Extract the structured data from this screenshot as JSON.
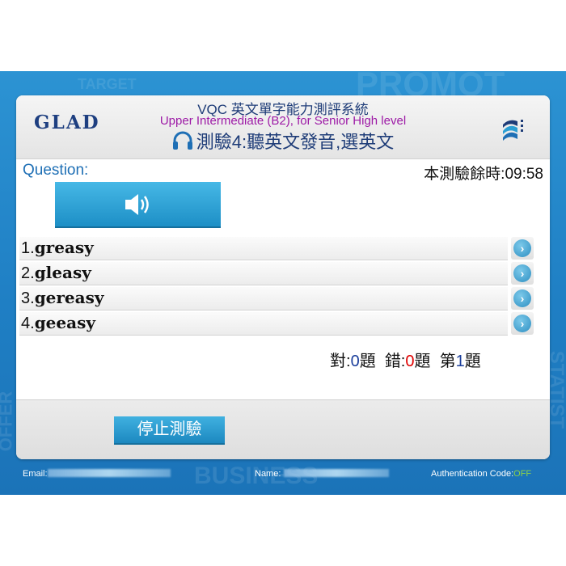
{
  "background_words": [
    "TARGET",
    "PROMOT",
    "BUSINESS",
    "OFFER",
    "STATIST"
  ],
  "header": {
    "logo": "GLAD",
    "app_title": "VQC 英文單字能力測評系統",
    "level": "Upper Intermediate (B2), for Senior High level",
    "test_name": "測驗4:聽英文發音,選英文"
  },
  "question": {
    "label": "Question:",
    "timer_label": "本測驗餘時:",
    "timer_value": "09:58"
  },
  "options": [
    {
      "num": "1.",
      "word": "greasy"
    },
    {
      "num": "2.",
      "word": "gleasy"
    },
    {
      "num": "3.",
      "word": "gereasy"
    },
    {
      "num": "4.",
      "word": "geeasy"
    }
  ],
  "score": {
    "correct_label": "對:",
    "correct_value": "0",
    "correct_unit": "題",
    "wrong_label": "錯:",
    "wrong_value": "0",
    "wrong_unit": "題",
    "number_label": "第",
    "number_value": "1",
    "number_unit": "題"
  },
  "stop_button": "停止測驗",
  "footer": {
    "email_label": "Email:",
    "name_label": "Name:",
    "auth_label": "Authentication Code:",
    "auth_value": "OFF"
  },
  "colors": {
    "brand_blue": "#1e3c78",
    "level_purple": "#9d1aa6",
    "button_blue": "#2b9fd4",
    "wrong_red": "#e00000",
    "auth_green": "#8cd14a"
  }
}
